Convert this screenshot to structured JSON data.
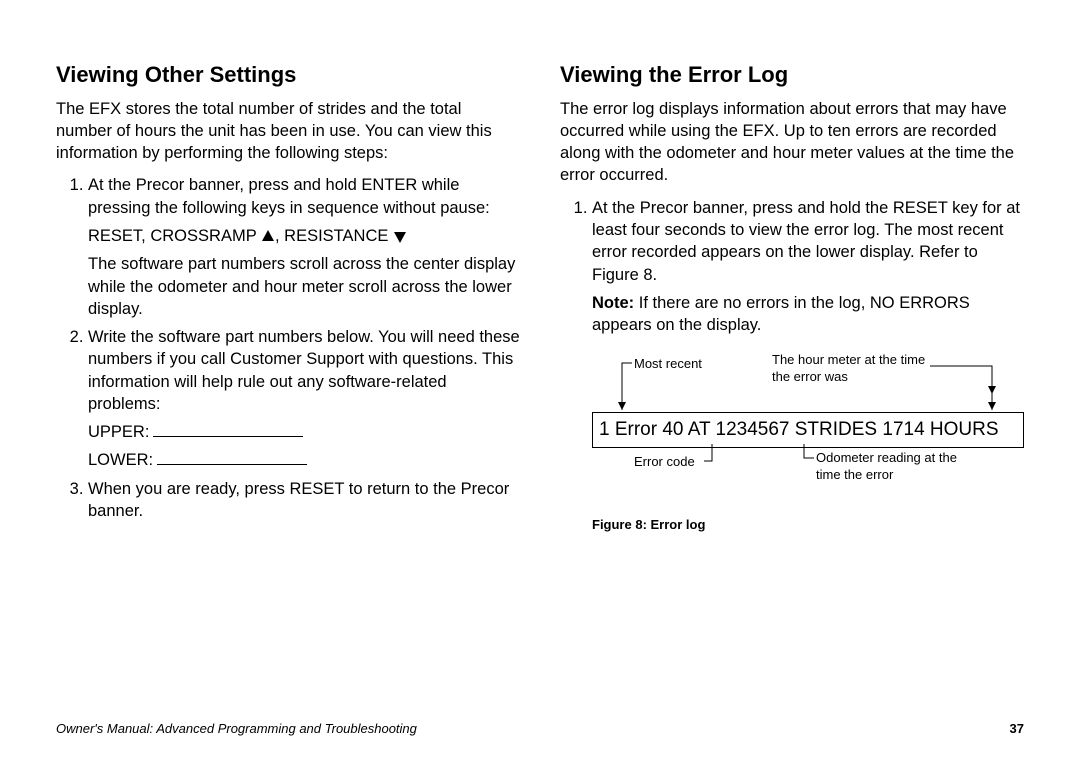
{
  "left": {
    "heading": "Viewing Other Settings",
    "intro": "The EFX stores the total number of strides and the total number of hours the unit has been in use. You can view this information by performing the following steps:",
    "step1a": "At the Precor banner, press and hold ENTER while pressing the following keys in sequence without pause:",
    "keyseq_a": "RESET, CROSSRAMP ",
    "keyseq_b": ", RESISTANCE ",
    "step1b": "The software part numbers scroll across the center display while the odometer and hour meter scroll across the lower display.",
    "step2": "Write the software part numbers below. You will need these numbers if you call Customer Support with questions. This information will help rule out any software-related problems:",
    "upper": "UPPER:",
    "lower": "LOWER:",
    "step3": "When you are ready, press RESET to return to the Precor banner."
  },
  "right": {
    "heading": "Viewing the Error Log",
    "intro": "The error log displays information about errors that may have occurred while using the EFX. Up to ten errors are recorded along with the odometer and hour meter values at the time the error occurred.",
    "step1": "At the Precor banner, press and hold the RESET key for at least four seconds to view the error log. The most recent error recorded appears on the lower display. Refer to Figure 8.",
    "note_label": "Note:",
    "note_body": " If there are no errors in the log, NO ERRORS appears on the display.",
    "err_display": "1 Error 40 AT 1234567 STRIDES 1714 HOURS",
    "c_mostrecent": "Most recent",
    "c_hourmeter": "The hour meter at the time the error was",
    "c_errorcode": "Error code",
    "c_odometer": "Odometer reading at the time the error",
    "figcap": "Figure 8: Error log"
  },
  "footer": {
    "title": "Owner's Manual: Advanced Programming and Troubleshooting",
    "page": "37"
  }
}
